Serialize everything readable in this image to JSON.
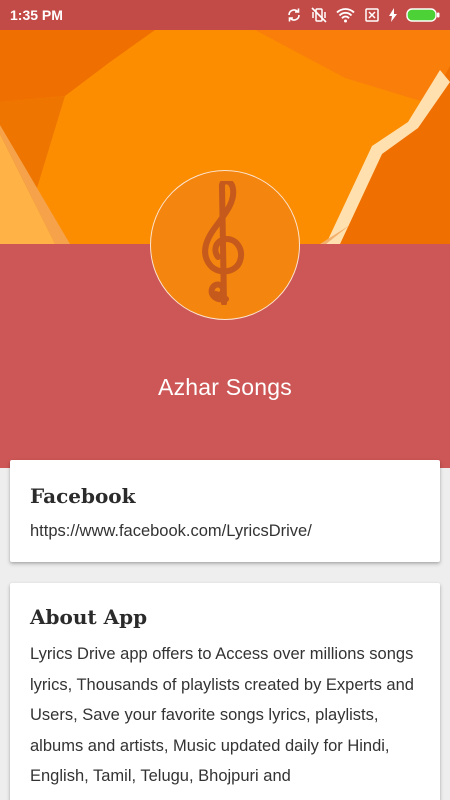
{
  "status_bar": {
    "time": "1:35 PM",
    "icons": [
      "sync-icon",
      "vibrate-off-icon",
      "wifi-icon",
      "no-sim-icon",
      "charging-icon",
      "battery-icon"
    ],
    "battery_color": "#4cd137"
  },
  "profile": {
    "icon": "treble-clef-icon",
    "name": "Azhar Songs"
  },
  "facebook_card": {
    "title": "Facebook",
    "url": "https://www.facebook.com/LyricsDrive/"
  },
  "about_card": {
    "title": "About App",
    "text": "Lyrics Drive app offers to Access over millions songs lyrics, Thousands of playlists created by Experts and Users, Save your favorite songs lyrics, playlists, albums and artists, Music updated daily for Hindi, English, Tamil, Telugu, Bhojpuri and"
  },
  "colors": {
    "status_bar": "#c24b47",
    "header_orange": "#fd8d00",
    "profile_band": "#cd5756",
    "avatar": "#f4850e",
    "clef": "#c55a1c"
  }
}
